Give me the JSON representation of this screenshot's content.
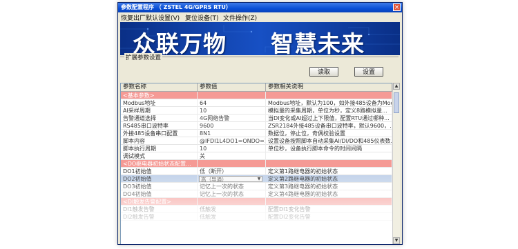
{
  "window": {
    "title": "参数配置程序 （ ZSTEL 4G/GPRS RTU）",
    "close_glyph": "×"
  },
  "menu": [
    {
      "label": "恢复出厂默认设置(V)"
    },
    {
      "label": "复位设备(T)"
    },
    {
      "label": "文件操作(Z)"
    }
  ],
  "banner": {
    "left": "众联万物",
    "right": "智慧未来"
  },
  "group": {
    "label": "扩展参数设置"
  },
  "buttons": {
    "read": "读取",
    "set": "设置"
  },
  "table": {
    "headers": [
      "参数名称",
      "参数值",
      "参数相关说明"
    ],
    "rows": [
      {
        "type": "section",
        "name": "<基本参数>",
        "value": "",
        "desc": ""
      },
      {
        "type": "row",
        "name": "Modbus地址",
        "value": "64",
        "desc": "Modbus地址，默认为100，如外接485设备为Mod..."
      },
      {
        "type": "row",
        "name": "AI采样周期",
        "value": "10",
        "desc": "模拟量的采集周期，单位为秒，定义8路模拟量..."
      },
      {
        "type": "row",
        "name": "告警通道选择",
        "value": "4G网络告警",
        "desc": "当DI变化或AI超过上下限值，配置RTU通过哪种..."
      },
      {
        "type": "row",
        "name": "RS485串口波特率",
        "value": "9600",
        "desc": "ZSR2184外接485设备串口波特率，默认9600，..."
      },
      {
        "type": "row",
        "name": "外接485设备串口配置",
        "value": "8N1",
        "desc": "数据位，停止位，奇偶校验设置"
      },
      {
        "type": "row",
        "name": "脚本内容",
        "value": "@IFDI1L4DO1=ONDO=1%ENDIF",
        "desc": "设置设备按照脚本自动采集AI/DI/DO和485仪表数..."
      },
      {
        "type": "row",
        "name": "脚本执行周期",
        "value": "10",
        "desc": "单位秒，设备执行脚本命令的时间间隔"
      },
      {
        "type": "row",
        "name": "调试模式",
        "value": "关",
        "desc": ""
      },
      {
        "type": "section",
        "name": "<DO继电器初始状态配置...",
        "value": "",
        "desc": ""
      },
      {
        "type": "row",
        "name": "DO1初始值",
        "value": "低（断开）",
        "desc": "定义第1路继电器的初始状态"
      },
      {
        "type": "selected",
        "name": "DO2初始值",
        "value": "高（导通）",
        "desc": "定义第2路继电器的初始状态"
      },
      {
        "type": "row",
        "name": "DO3初始值",
        "value": "记忆上一次的状态",
        "desc": "定义第3路继电器的初始状态"
      },
      {
        "type": "row",
        "name": "DO4初始值",
        "value": "记忆上一次的状态",
        "desc": "定义第4路继电器的初始状态"
      },
      {
        "type": "section",
        "name": "<DI触发告警配置>",
        "value": "",
        "desc": ""
      },
      {
        "type": "row",
        "name": "DI1触发告警",
        "value": "低触发",
        "desc": "配置DI1变化告警"
      },
      {
        "type": "row",
        "name": "DI2触发告警",
        "value": "低触发",
        "desc": "配置DI2变化告警"
      }
    ]
  },
  "colors": {
    "section": "#f59a95",
    "selected": "#c3d3ea",
    "title": "#0a4fd6"
  }
}
